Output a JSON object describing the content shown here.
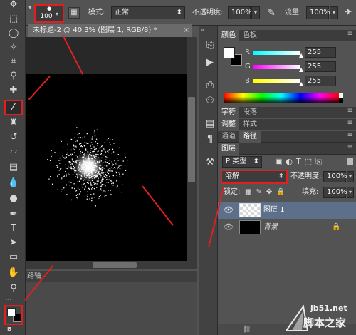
{
  "options_bar": {
    "brush_size": "100",
    "mode_label": "模式:",
    "mode_value": "正常",
    "opacity_label": "不透明度:",
    "opacity_value": "100%",
    "flow_label": "流量:",
    "flow_value": "100%"
  },
  "document": {
    "tab_title": "未标题-2 @ 40.3% (图层 1, RGB/8) *"
  },
  "bottom_panel": {
    "tab_label": "路轴"
  },
  "color_panel": {
    "tabs": [
      "颜色",
      "色板"
    ],
    "channels": [
      {
        "name": "R",
        "value": "255"
      },
      {
        "name": "G",
        "value": "255"
      },
      {
        "name": "B",
        "value": "255"
      }
    ]
  },
  "panel_groups": [
    {
      "tabs": [
        "字符",
        "段落"
      ]
    },
    {
      "tabs": [
        "调整",
        "样式"
      ]
    },
    {
      "tabs": [
        "通道",
        "路径"
      ]
    }
  ],
  "layers_panel": {
    "title": "图层",
    "filter_value": "P 类型",
    "blend_mode": "溶解",
    "opacity_label": "不透明度:",
    "opacity_value": "100%",
    "lock_label": "锁定:",
    "fill_label": "填充:",
    "fill_value": "100%",
    "layers": [
      {
        "name": "图层 1",
        "selected": true
      },
      {
        "name": "背景",
        "selected": false
      }
    ]
  },
  "watermark": {
    "url": "jb51.net",
    "name": "脚本之家"
  },
  "colors": {
    "accent_red": "#e02020",
    "panel_bg": "#535353",
    "selected_layer": "#5e6f8a"
  }
}
